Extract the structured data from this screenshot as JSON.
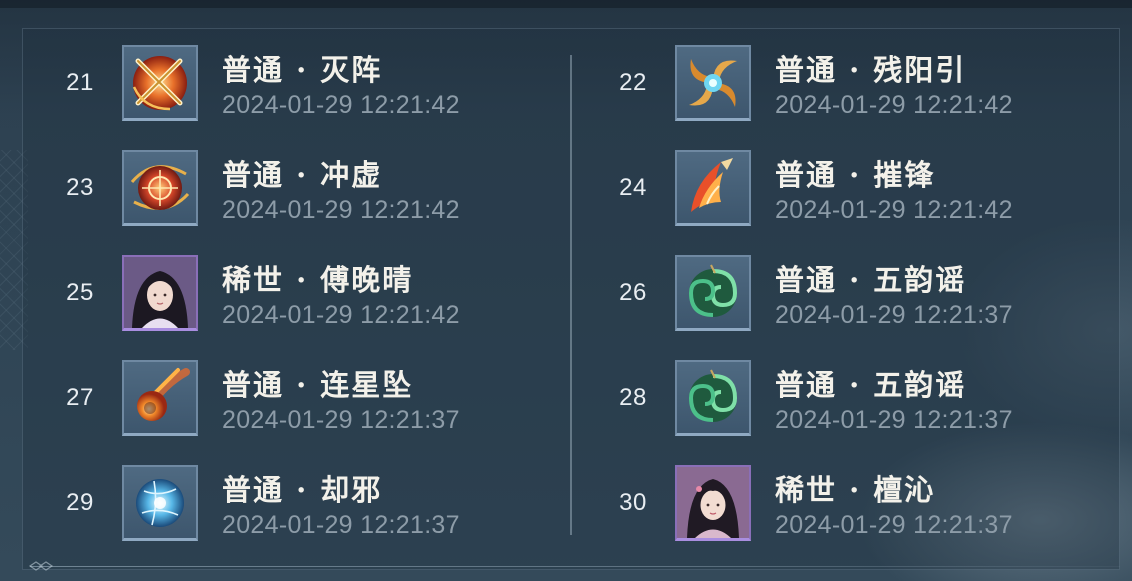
{
  "colors": {
    "text_primary": "#f3f1ea",
    "text_timestamp": "#8d9ca8",
    "frame_normal": "#6f89a2",
    "frame_rare": "#8a6fb8",
    "background": "#2f4454"
  },
  "records": [
    {
      "number": "21",
      "title": "普通 · 灭阵",
      "time": "2024-01-29 12:21:42",
      "rarity": "normal",
      "icon": "crossed-swords-icon"
    },
    {
      "number": "22",
      "title": "普通 · 残阳引",
      "time": "2024-01-29 12:21:42",
      "rarity": "normal",
      "icon": "golden-vortex-icon"
    },
    {
      "number": "23",
      "title": "普通 · 冲虚",
      "time": "2024-01-29 12:21:42",
      "rarity": "normal",
      "icon": "crosshair-orb-icon"
    },
    {
      "number": "24",
      "title": "普通 · 摧锋",
      "time": "2024-01-29 12:21:42",
      "rarity": "normal",
      "icon": "flame-blade-icon"
    },
    {
      "number": "25",
      "title": "稀世 · 傅晚晴",
      "time": "2024-01-29 12:21:42",
      "rarity": "rare",
      "icon": "character-portrait-icon"
    },
    {
      "number": "26",
      "title": "普通 · 五韵谣",
      "time": "2024-01-29 12:21:37",
      "rarity": "normal",
      "icon": "jade-swirl-icon"
    },
    {
      "number": "27",
      "title": "普通 · 连星坠",
      "time": "2024-01-29 12:21:37",
      "rarity": "normal",
      "icon": "meteor-icon"
    },
    {
      "number": "28",
      "title": "普通 · 五韵谣",
      "time": "2024-01-29 12:21:37",
      "rarity": "normal",
      "icon": "jade-swirl-icon"
    },
    {
      "number": "29",
      "title": "普通 · 却邪",
      "time": "2024-01-29 12:21:37",
      "rarity": "normal",
      "icon": "ice-orb-icon"
    },
    {
      "number": "30",
      "title": "稀世 · 檀沁",
      "time": "2024-01-29 12:21:37",
      "rarity": "rare",
      "icon": "character-portrait-icon"
    }
  ]
}
